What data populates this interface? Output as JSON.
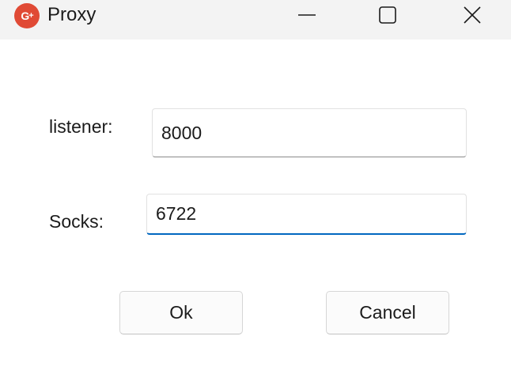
{
  "window": {
    "title": "Proxy",
    "app_icon_label": "G+",
    "controls": {
      "minimize_icon": "minimize-icon",
      "maximize_icon": "maximize-icon",
      "close_icon": "close-icon"
    }
  },
  "form": {
    "listener_label": "listener:",
    "listener_value": "8000",
    "socks_label": "Socks:",
    "socks_value": "6722"
  },
  "buttons": {
    "ok_label": "Ok",
    "cancel_label": "Cancel"
  },
  "colors": {
    "titlebar": "#f3f3f3",
    "app_icon": "#e04a35",
    "focus_accent": "#0067c0"
  }
}
